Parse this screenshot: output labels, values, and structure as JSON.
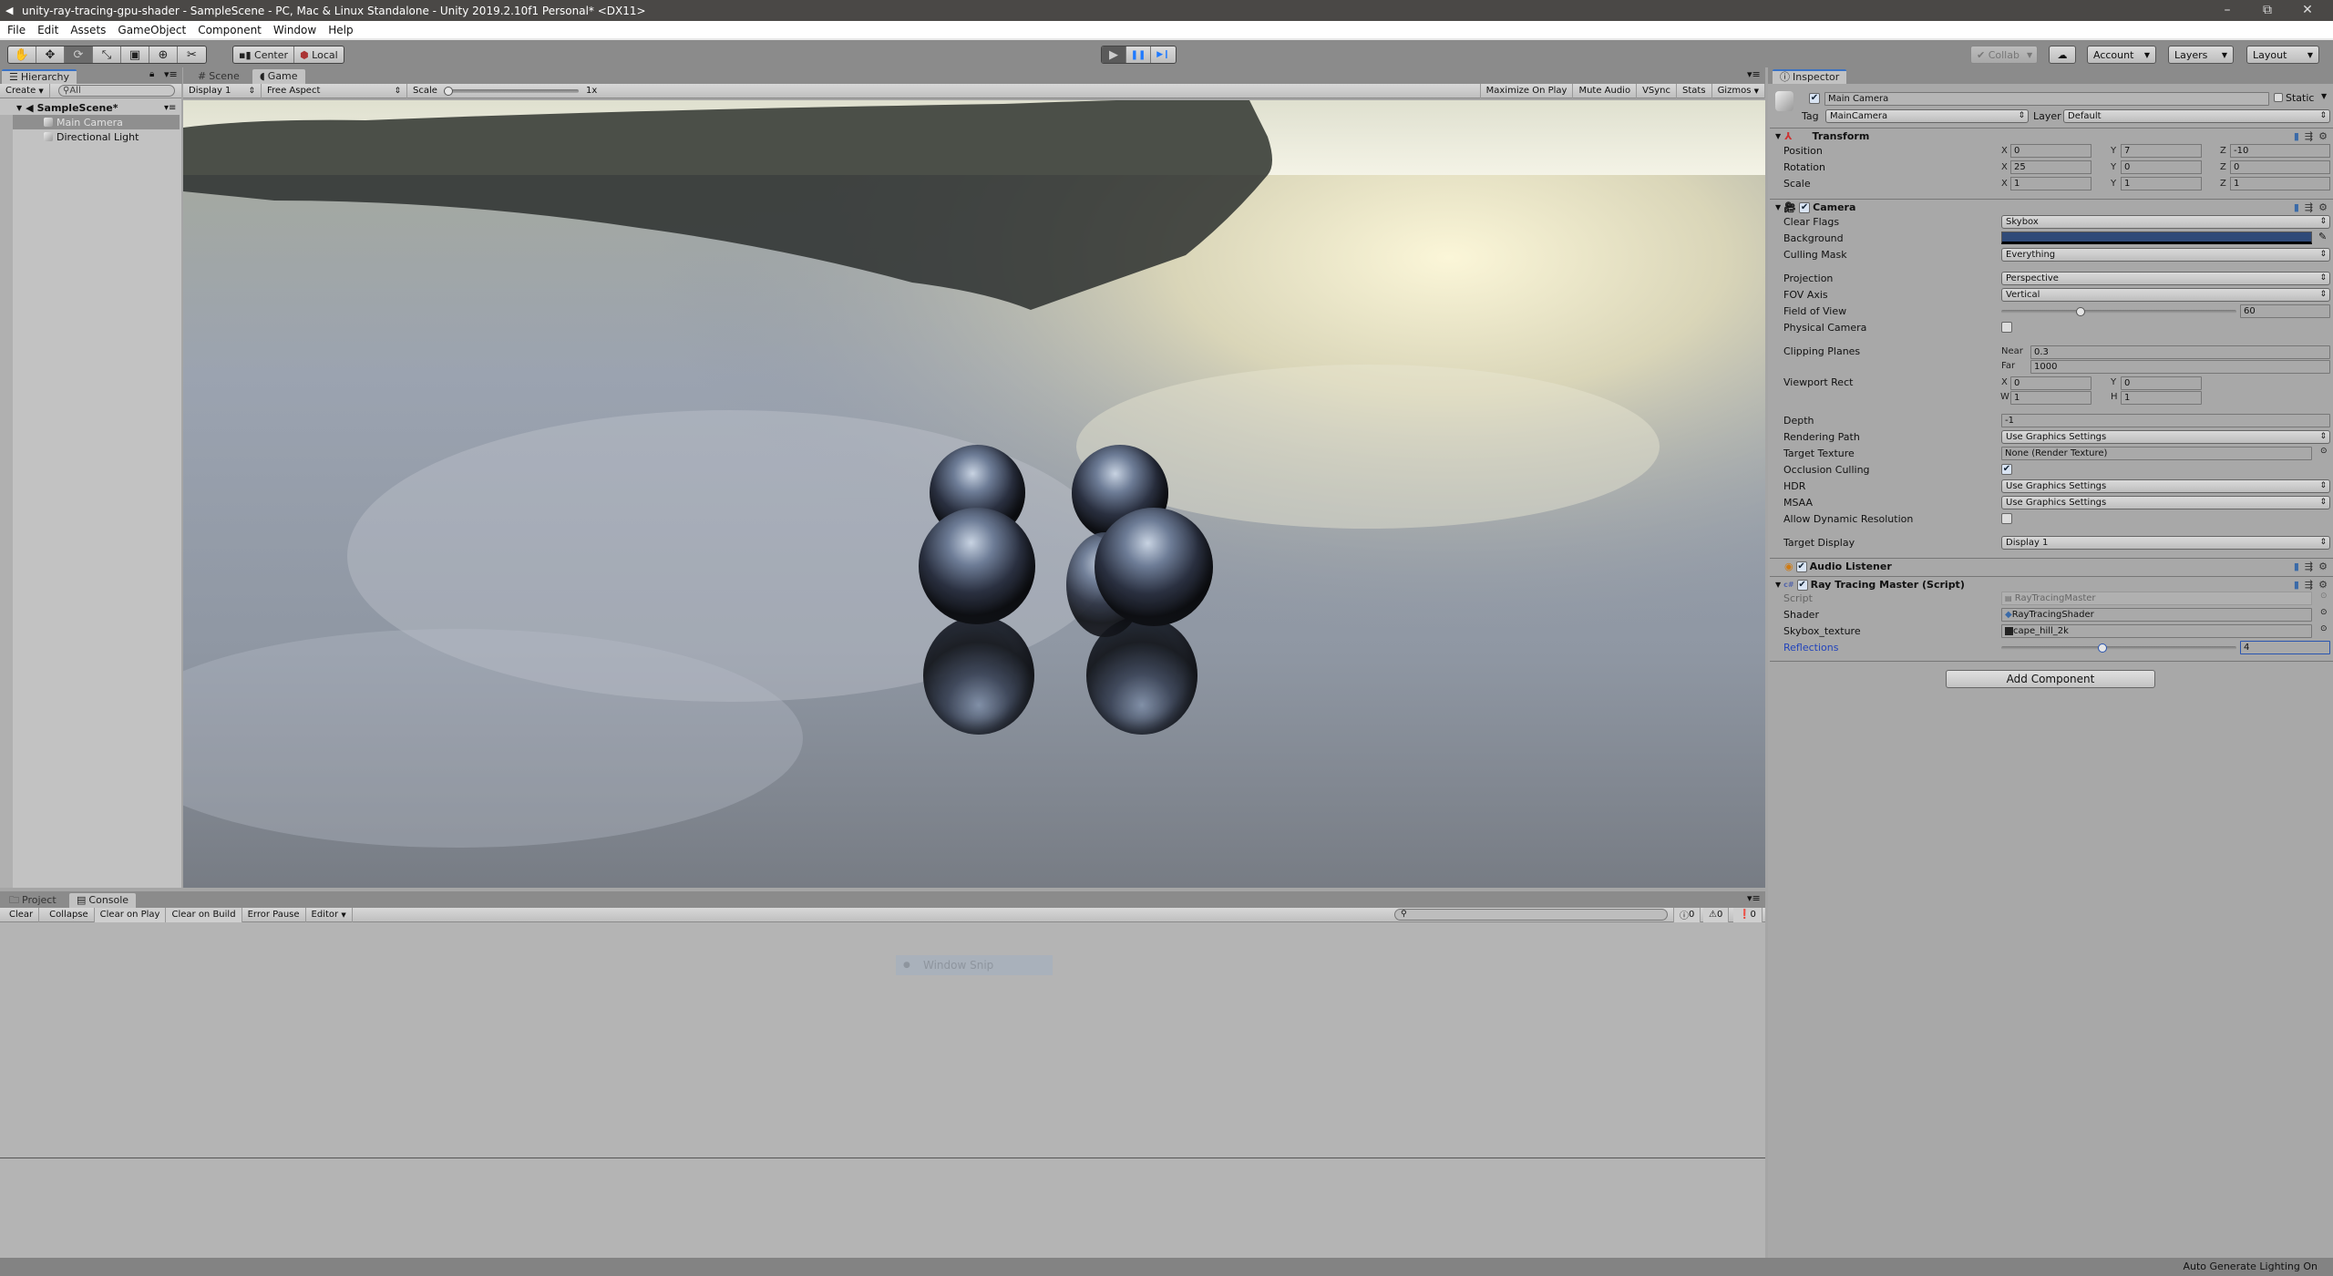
{
  "window": {
    "title": "unity-ray-tracing-gpu-shader - SampleScene - PC, Mac & Linux Standalone - Unity 2019.2.10f1 Personal* <DX11>",
    "controls": {
      "minimize": "–",
      "maximize": "⧉",
      "close": "✕"
    }
  },
  "menu": [
    "File",
    "Edit",
    "Assets",
    "GameObject",
    "Component",
    "Window",
    "Help"
  ],
  "toolbar": {
    "tools": [
      "hand-tool",
      "move-tool",
      "rotate-tool",
      "scale-tool",
      "rect-tool",
      "transform-tool",
      "custom-tool"
    ],
    "tool_glyphs": [
      "✋",
      "✥",
      "⟳",
      "⤡",
      "▣",
      "⊕",
      "✂"
    ],
    "active_tool": "rotate-tool",
    "pivot_mode": "Center",
    "pivot_rotation": "Local",
    "play": "▶",
    "pause": "❚❚",
    "step": "▶❙",
    "play_active": true,
    "collab": "Collab",
    "cloud": "☁",
    "account": "Account",
    "layers": "Layers",
    "layout": "Layout"
  },
  "hierarchy": {
    "tab": "Hierarchy",
    "create": "Create",
    "search_placeholder": "All",
    "scene": "SampleScene*",
    "items": [
      "Main Camera",
      "Directional Light"
    ],
    "selected": "Main Camera"
  },
  "game_view": {
    "tabs": [
      "Scene",
      "Game"
    ],
    "active_tab": "Game",
    "display": "Display 1",
    "aspect": "Free Aspect",
    "scale_label": "Scale",
    "scale_value": "1x",
    "scale_fraction": 0.0,
    "toggles": [
      "Maximize On Play",
      "Mute Audio",
      "VSync",
      "Stats",
      "Gizmos"
    ]
  },
  "inspector": {
    "tab": "Inspector",
    "object_name": "Main Camera",
    "object_active": true,
    "static_label": "Static",
    "tag_label": "Tag",
    "tag": "MainCamera",
    "layer_label": "Layer",
    "layer": "Default",
    "transform": {
      "title": "Transform",
      "rows": [
        {
          "label": "Position",
          "x": "0",
          "y": "7",
          "z": "-10"
        },
        {
          "label": "Rotation",
          "x": "25",
          "y": "0",
          "z": "0"
        },
        {
          "label": "Scale",
          "x": "1",
          "y": "1",
          "z": "1"
        }
      ]
    },
    "camera": {
      "title": "Camera",
      "clear_flags": {
        "label": "Clear Flags",
        "value": "Skybox"
      },
      "background": {
        "label": "Background",
        "color": "#2f4a78"
      },
      "culling_mask": {
        "label": "Culling Mask",
        "value": "Everything"
      },
      "projection": {
        "label": "Projection",
        "value": "Perspective"
      },
      "fov_axis": {
        "label": "FOV Axis",
        "value": "Vertical"
      },
      "fov": {
        "label": "Field of View",
        "value": "60",
        "min": 1,
        "max": 179
      },
      "physical_camera": {
        "label": "Physical Camera",
        "checked": false
      },
      "clipping": {
        "label": "Clipping Planes",
        "near_label": "Near",
        "near": "0.3",
        "far_label": "Far",
        "far": "1000"
      },
      "viewport": {
        "label": "Viewport Rect",
        "x": "0",
        "y": "0",
        "w": "1",
        "h": "1"
      },
      "depth": {
        "label": "Depth",
        "value": "-1"
      },
      "rendering_path": {
        "label": "Rendering Path",
        "value": "Use Graphics Settings"
      },
      "target_texture": {
        "label": "Target Texture",
        "value": "None (Render Texture)"
      },
      "occlusion_culling": {
        "label": "Occlusion Culling",
        "checked": true
      },
      "hdr": {
        "label": "HDR",
        "value": "Use Graphics Settings"
      },
      "msaa": {
        "label": "MSAA",
        "value": "Use Graphics Settings"
      },
      "dynamic_resolution": {
        "label": "Allow Dynamic Resolution",
        "checked": false
      },
      "target_display": {
        "label": "Target Display",
        "value": "Display 1"
      }
    },
    "audio_listener": {
      "title": "Audio Listener"
    },
    "ray_tracing": {
      "title": "Ray Tracing Master (Script)",
      "script": {
        "label": "Script",
        "value": "RayTracingMaster"
      },
      "shader": {
        "label": "Shader",
        "value": "RayTracingShader"
      },
      "skybox": {
        "label": "Skybox_texture",
        "value": "cape_hill_2k"
      },
      "reflections": {
        "label": "Reflections",
        "value": "4",
        "min": 1,
        "max": 8
      }
    },
    "add_component": "Add Component"
  },
  "console": {
    "tabs": [
      "Project",
      "Console"
    ],
    "active_tab": "Console",
    "buttons": [
      "Clear",
      "Collapse",
      "Clear on Play",
      "Clear on Build",
      "Error Pause",
      "Editor"
    ],
    "search_placeholder": "",
    "counts": {
      "info": "0",
      "warn": "0",
      "error": "0"
    },
    "overlay": "Window Snip"
  },
  "status_bar": {
    "text": "Auto Generate Lighting On"
  }
}
